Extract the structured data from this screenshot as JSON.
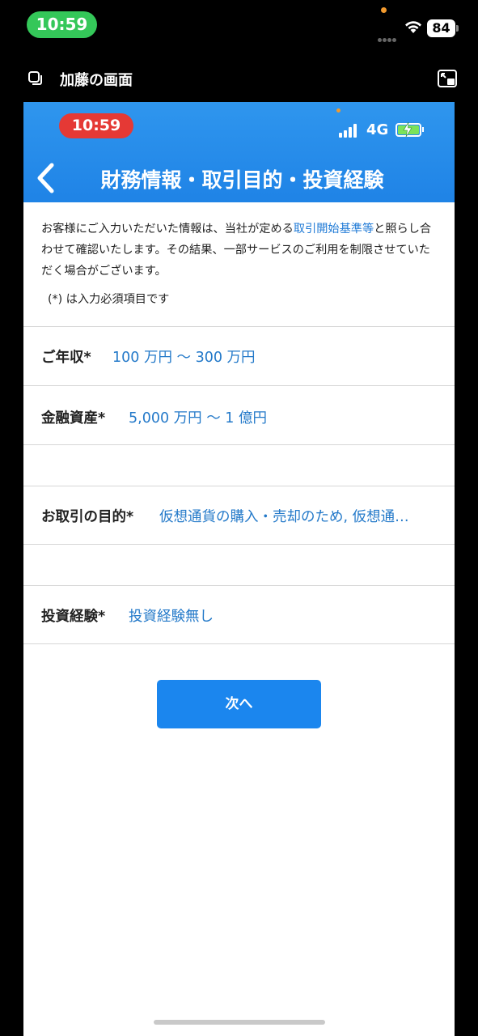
{
  "device": {
    "time": "10:59",
    "battery": "84"
  },
  "share": {
    "title": "加藤の画面"
  },
  "app": {
    "status": {
      "time": "10:59",
      "network": "4G"
    },
    "header": {
      "title": "財務情報・取引目的・投資経験"
    },
    "notice": {
      "text_before": "お客様にご入力いただいた情報は、当社が定める",
      "link": "取引開始基準等",
      "text_after": "と照らし合わせて確認いたします。その結果、一部サービスのご利用を制限させていただく場合がございます。"
    },
    "required_note": "(*) は入力必須項目です",
    "fields": {
      "income": {
        "label": "ご年収*",
        "value": "100 万円 〜 300 万円"
      },
      "assets": {
        "label": "金融資産*",
        "value": "5,000 万円 〜 1 億円"
      },
      "purpose": {
        "label": "お取引の目的*",
        "value": "仮想通貨の購入・売却のため, 仮想通…"
      },
      "experience": {
        "label": "投資経験*",
        "value": "投資経験無し"
      }
    },
    "next_button": "次へ"
  },
  "colors": {
    "accent": "#1b86ee",
    "link": "#2379c9",
    "header": "#1f83e6",
    "device_time_pill": "#34c759",
    "app_time_pill": "#e53935"
  }
}
